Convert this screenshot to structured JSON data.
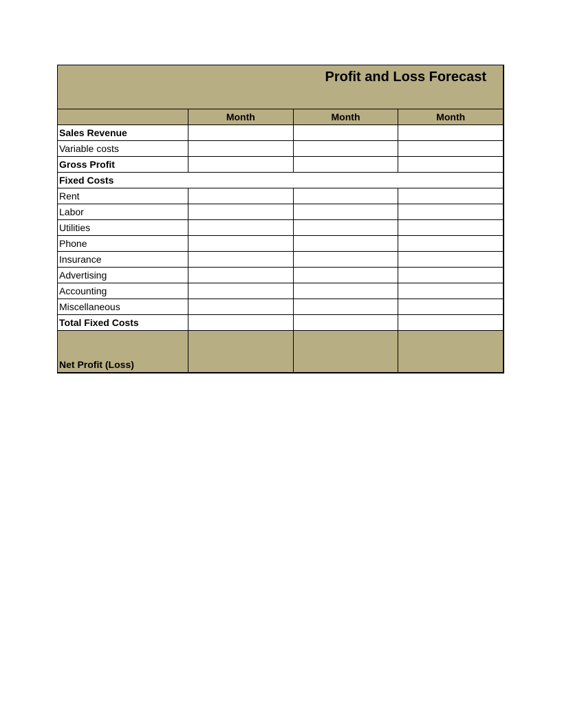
{
  "title": "Profit and Loss Forecast",
  "headers": {
    "label": "",
    "col1": "Month",
    "col2": "Month",
    "col3": "Month"
  },
  "rows": {
    "sales_revenue": "Sales Revenue",
    "variable_costs": "Variable costs",
    "gross_profit": "Gross Profit",
    "fixed_costs_header": "Fixed Costs",
    "rent": "Rent",
    "labor": "Labor",
    "utilities": "Utilities",
    "phone": "Phone",
    "insurance": "Insurance",
    "advertising": "Advertising",
    "accounting": "Accounting",
    "miscellaneous": "Miscellaneous",
    "total_fixed_costs": "Total Fixed Costs",
    "net_profit_loss": "Net Profit (Loss)"
  },
  "values": {
    "sales_revenue": {
      "c1": "",
      "c2": "",
      "c3": ""
    },
    "variable_costs": {
      "c1": "",
      "c2": "",
      "c3": ""
    },
    "gross_profit": {
      "c1": "",
      "c2": "",
      "c3": ""
    },
    "rent": {
      "c1": "",
      "c2": "",
      "c3": ""
    },
    "labor": {
      "c1": "",
      "c2": "",
      "c3": ""
    },
    "utilities": {
      "c1": "",
      "c2": "",
      "c3": ""
    },
    "phone": {
      "c1": "",
      "c2": "",
      "c3": ""
    },
    "insurance": {
      "c1": "",
      "c2": "",
      "c3": ""
    },
    "advertising": {
      "c1": "",
      "c2": "",
      "c3": ""
    },
    "accounting": {
      "c1": "",
      "c2": "",
      "c3": ""
    },
    "miscellaneous": {
      "c1": "",
      "c2": "",
      "c3": ""
    },
    "total_fixed_costs": {
      "c1": "",
      "c2": "",
      "c3": ""
    },
    "net_profit_loss": {
      "c1": "",
      "c2": "",
      "c3": ""
    }
  }
}
